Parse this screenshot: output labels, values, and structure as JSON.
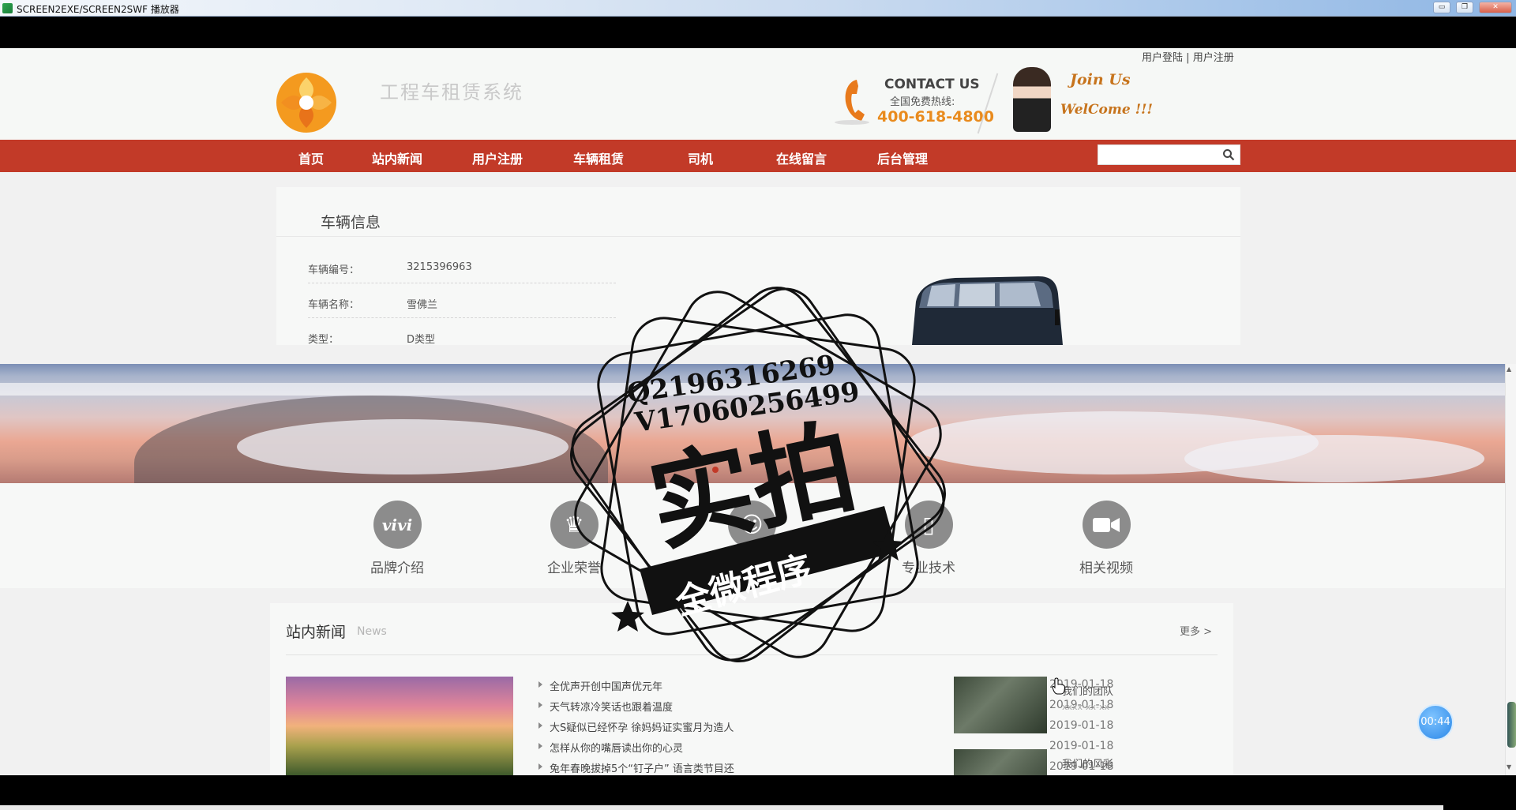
{
  "window": {
    "title": "SCREEN2EXE/SCREEN2SWF 播放器",
    "btn_min": "▭",
    "btn_max": "❐",
    "btn_close": "✕"
  },
  "header": {
    "login_link": "用户登陆",
    "separator": "|",
    "register_link": "用户注册",
    "site_name": "工程车租赁系统",
    "contact_title": "CONTACT US",
    "contact_sub": "全国免费热线:",
    "contact_phone": "400-618-4800",
    "join_title": "Join Us",
    "join_sub": "WelCome !!!"
  },
  "nav": {
    "items": [
      {
        "label": "首页"
      },
      {
        "label": "站内新闻"
      },
      {
        "label": "用户注册"
      },
      {
        "label": "车辆租赁"
      },
      {
        "label": "司机"
      },
      {
        "label": "在线留言"
      },
      {
        "label": "后台管理"
      }
    ],
    "search_value": ""
  },
  "vehicle": {
    "section_title": "车辆信息",
    "rows": [
      {
        "label": "车辆编号：",
        "value": "3215396963"
      },
      {
        "label": "车辆名称：",
        "value": "雪佛兰"
      },
      {
        "label": "类型：",
        "value": "D类型"
      }
    ]
  },
  "features": [
    {
      "label": "品牌介绍",
      "icon": "vivi-icon",
      "glyph": "vivi"
    },
    {
      "label": "企业荣誉",
      "icon": "trophy-icon",
      "glyph": "♛"
    },
    {
      "label": "团队力量",
      "icon": "team-icon",
      "glyph": "☺"
    },
    {
      "label": "专业技术",
      "icon": "book-icon",
      "glyph": "▯"
    },
    {
      "label": "相关视频",
      "icon": "video-camera-icon",
      "glyph": "■"
    }
  ],
  "news": {
    "title": "站内新闻",
    "subtitle": "News",
    "more": "更多 >",
    "items": [
      {
        "title": "全优声开创中国声优元年",
        "date": "2019-01-18"
      },
      {
        "title": "天气转凉冷笑话也跟着温度",
        "date": "2019-01-18"
      },
      {
        "title": "大S疑似已经怀孕 徐妈妈证实蜜月为造人",
        "date": "2019-01-18"
      },
      {
        "title": "怎样从你的嘴唇读出你的心灵",
        "date": "2019-01-18"
      },
      {
        "title": "兔年春晚拔掉5个“钉子户” 语言类节目还",
        "date": "2019-01-18"
      }
    ],
    "team": [
      {
        "title": "我们的团队",
        "sub": "xxxx-xx-xx"
      },
      {
        "title": "我们的风彩",
        "sub": ""
      }
    ]
  },
  "watermark": {
    "qq": "Q2196316269",
    "wechat": "V17060256499",
    "big": "实拍",
    "ribbon": "全微程序"
  },
  "timer": "00:44",
  "colors": {
    "nav_red": "#c23a28",
    "phone_orange": "#e98b1e",
    "join_orange": "#c7741d"
  }
}
